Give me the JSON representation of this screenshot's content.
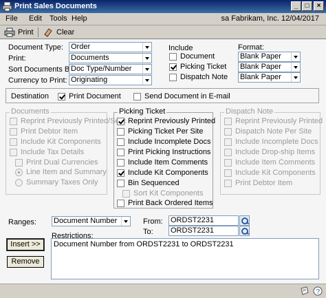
{
  "window": {
    "title": "Print Sales Documents"
  },
  "menu": {
    "items": [
      "File",
      "Edit",
      "Tools",
      "Help"
    ],
    "company": "sa  Fabrikam, Inc.  12/04/2017"
  },
  "toolbar": {
    "print_label": "Print",
    "clear_label": "Clear"
  },
  "fields": {
    "document_type": {
      "label": "Document Type:",
      "value": "Order"
    },
    "print": {
      "label": "Print:",
      "value": "Documents"
    },
    "sort_by": {
      "label": "Sort Documents By:",
      "value": "Doc Type/Number"
    },
    "currency": {
      "label": "Currency to Print:",
      "value": "Originating"
    }
  },
  "include": {
    "heading": "Include",
    "items": [
      {
        "label": "Document",
        "checked": false
      },
      {
        "label": "Picking Ticket",
        "checked": true
      },
      {
        "label": "Dispatch Note",
        "checked": false
      }
    ]
  },
  "format": {
    "heading": "Format:",
    "values": [
      "Blank Paper",
      "Blank Paper",
      "Blank Paper"
    ]
  },
  "destination": {
    "label": "Destination",
    "print_document": "Print Document",
    "send_email": "Send Document in E-mail"
  },
  "documents_group": {
    "label": "Documents",
    "items": [
      "Reprint Previously Printed/Sent",
      "Print Debtor Item",
      "Include Kit Components",
      "Include Tax Details",
      "Print Dual Currencies",
      "Line Item and Summary",
      "Summary Taxes Only"
    ]
  },
  "picking_group": {
    "label": "Picking Ticket",
    "items": [
      {
        "label": "Reprint Previously Printed",
        "checked": true
      },
      {
        "label": "Picking Ticket Per Site",
        "checked": false
      },
      {
        "label": "Include Incomplete Docs",
        "checked": false
      },
      {
        "label": "Print Picking Instructions",
        "checked": false
      },
      {
        "label": "Include Item Comments",
        "checked": false
      },
      {
        "label": "Include Kit Components",
        "checked": true
      },
      {
        "label": "Bin Sequenced",
        "checked": false
      },
      {
        "label": "Sort Kit Components",
        "checked": false
      },
      {
        "label": "Print Back Ordered Items",
        "checked": false
      }
    ]
  },
  "dispatch_group": {
    "label": "Dispatch Note",
    "items": [
      "Reprint Previously Printed",
      "Dispatch Note Per Site",
      "Include Incomplete Docs",
      "Include Drop-ship Items",
      "Include Item Comments",
      "Include Kit Components",
      "Print Debtor Item"
    ]
  },
  "ranges": {
    "label": "Ranges:",
    "value": "Document Number",
    "from_label": "From:",
    "from_value": "ORDST2231",
    "to_label": "To:",
    "to_value": "ORDST2231"
  },
  "restrictions": {
    "label": "Restrictions:",
    "value": "Document Number from ORDST2231 to ORDST2231"
  },
  "buttons": {
    "insert": "Insert >>",
    "remove": "Remove"
  }
}
